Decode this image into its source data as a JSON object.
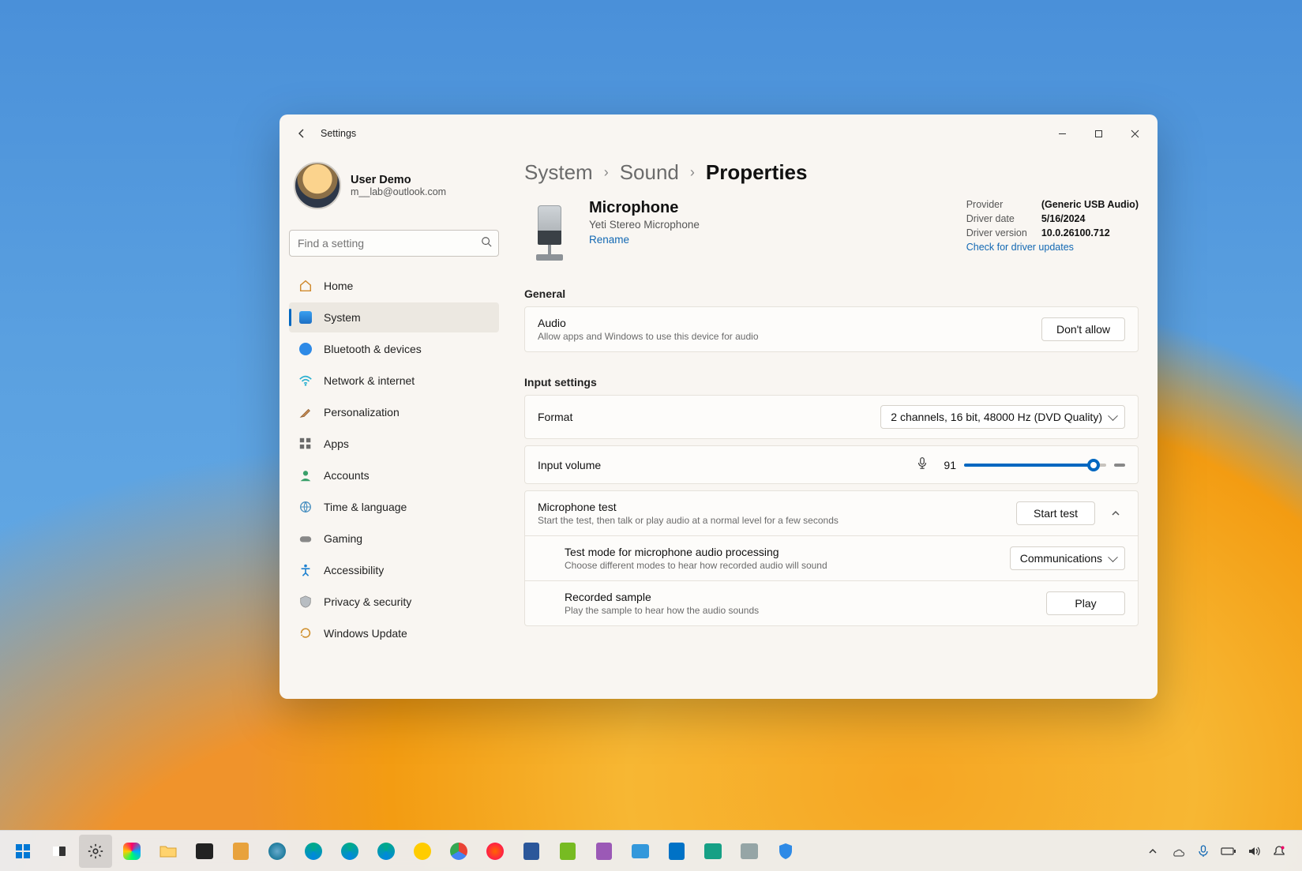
{
  "window": {
    "app_title": "Settings"
  },
  "profile": {
    "name": "User Demo",
    "email": "m__lab@outlook.com"
  },
  "search": {
    "placeholder": "Find a setting"
  },
  "nav": {
    "items": [
      {
        "label": "Home"
      },
      {
        "label": "System"
      },
      {
        "label": "Bluetooth & devices"
      },
      {
        "label": "Network & internet"
      },
      {
        "label": "Personalization"
      },
      {
        "label": "Apps"
      },
      {
        "label": "Accounts"
      },
      {
        "label": "Time & language"
      },
      {
        "label": "Gaming"
      },
      {
        "label": "Accessibility"
      },
      {
        "label": "Privacy & security"
      },
      {
        "label": "Windows Update"
      }
    ]
  },
  "breadcrumb": {
    "c0": "System",
    "c1": "Sound",
    "c2": "Properties"
  },
  "device": {
    "title": "Microphone",
    "subtitle": "Yeti Stereo Microphone",
    "rename": "Rename"
  },
  "driver": {
    "provider_label": "Provider",
    "provider_value": "(Generic USB Audio)",
    "date_label": "Driver date",
    "date_value": "5/16/2024",
    "version_label": "Driver version",
    "version_value": "10.0.26100.712",
    "check_link": "Check for driver updates"
  },
  "sections": {
    "general": "General",
    "input": "Input settings"
  },
  "general_card": {
    "audio_label": "Audio",
    "audio_desc": "Allow apps and Windows to use this device for audio",
    "dont_allow": "Don't allow"
  },
  "format_card": {
    "label": "Format",
    "value": "2 channels, 16 bit, 48000 Hz (DVD Quality)"
  },
  "volume_card": {
    "label": "Input volume",
    "value": "91",
    "percent": 91
  },
  "mic_test": {
    "label": "Microphone test",
    "desc": "Start the test, then talk or play audio at a normal level for a few seconds",
    "start": "Start test",
    "mode_label": "Test mode for microphone audio processing",
    "mode_desc": "Choose different modes to hear how recorded audio will sound",
    "mode_value": "Communications",
    "sample_label": "Recorded sample",
    "sample_desc": "Play the sample to hear how the audio sounds",
    "play": "Play"
  }
}
